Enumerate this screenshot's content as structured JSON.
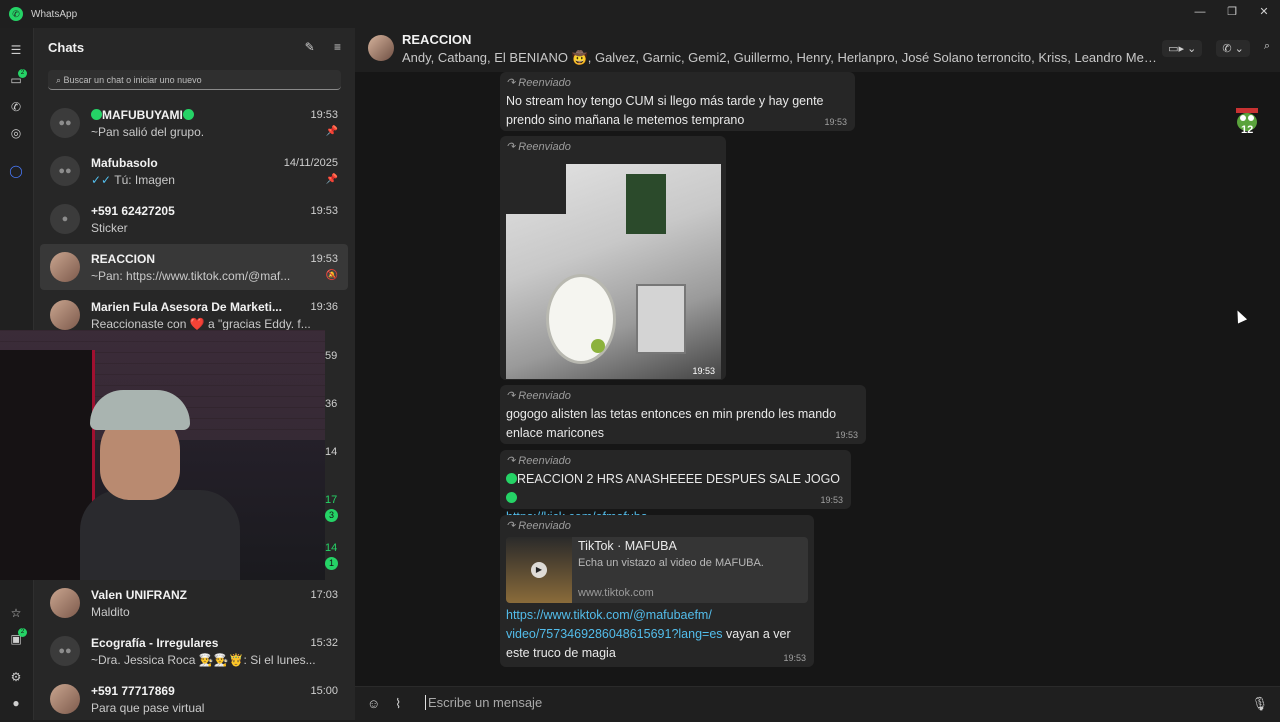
{
  "window": {
    "title": "WhatsApp",
    "controls": [
      "—",
      "❐",
      "✕"
    ]
  },
  "rail": {
    "badges": [
      "2",
      "2"
    ]
  },
  "sidebar": {
    "heading": "Chats",
    "search_placeholder": "Buscar un chat o iniciar uno nuevo",
    "chats": [
      {
        "name": "MAFUBUYAMI",
        "time": "19:53",
        "preview": "~Pan salió del grupo."
      },
      {
        "name": "Mafubasolo",
        "time": "14/11/2025",
        "preview": "Tú: Imagen"
      },
      {
        "name": "+591 62427205",
        "time": "19:53",
        "preview": "Sticker"
      },
      {
        "name": "REACCION",
        "time": "19:53",
        "preview": "~Pan: https://www.tiktok.com/@maf..."
      },
      {
        "name": "Marien Fula Asesora De Marketi...",
        "time": "19:36",
        "preview": "Reaccionaste con ❤️ a \"gracias Eddy. f..."
      },
      {
        "name": "Valen UNIFRANZ",
        "time": "17:03",
        "preview": "Maldito"
      },
      {
        "name": "Ecografía - Irregulares",
        "time": "15:32",
        "preview": "~Dra. Jessica Roca 👨‍🍳👨‍🍳🤴: Si el lunes..."
      },
      {
        "name": "+591 77717869",
        "time": "15:00",
        "preview": "Para que pase virtual"
      }
    ],
    "hidden_times": [
      "59",
      "36",
      "14",
      "17",
      "14"
    ],
    "hidden_badges": [
      "3",
      "1"
    ]
  },
  "header": {
    "title": "REACCION",
    "members": "Andy, Catbang, El BENIANO 🤠, Galvez, Garnic, Gemi2, Guillermo, Henry, Herlanpro, José Solano terroncito, Kriss, Leandro Mend..."
  },
  "messages": {
    "forwarded_label": "Reenviado",
    "m1": {
      "text": "No stream hoy tengo CUM si llego más tarde y hay gente prendo sino mañana le metemos temprano",
      "time": "19:53"
    },
    "m2": {
      "time": "19:53"
    },
    "m3": {
      "text": "gogogo alisten las tetas entonces en min prendo les mando enlace maricones",
      "time": "19:53"
    },
    "m4": {
      "text": "REACCION 2 HRS ANASHEEEE DESPUES SALE JOGO",
      "link": "https://kick.com/efmafuba",
      "time": "19:53"
    },
    "m5": {
      "preview_title": "TikTok · MAFUBA",
      "preview_desc": "Echa un vistazo al video de MAFUBA.",
      "preview_url": "www.tiktok.com",
      "link_1": "https://www.tiktok.com/@mafubaefm/",
      "link_2": "video/7573469286048615691?lang=es",
      "tail": " vayan a ver",
      "text_2": "este truco de magia",
      "time": "19:53"
    }
  },
  "sticker_count": "12",
  "compose": {
    "placeholder": "Escribe un mensaje"
  }
}
